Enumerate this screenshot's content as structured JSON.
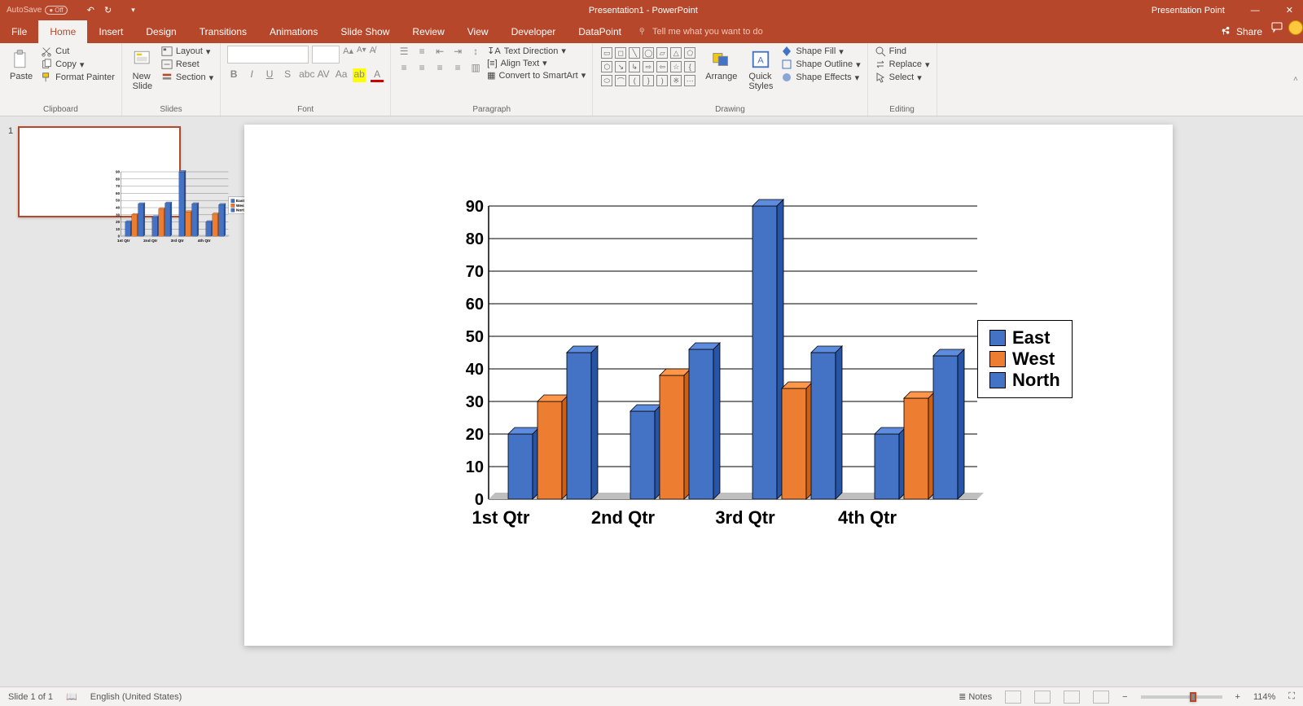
{
  "titlebar": {
    "autosave_label": "AutoSave",
    "autosave_state": "Off",
    "title": "Presentation1 - PowerPoint",
    "brand_right": "Presentation Point"
  },
  "tabs": {
    "items": [
      "File",
      "Home",
      "Insert",
      "Design",
      "Transitions",
      "Animations",
      "Slide Show",
      "Review",
      "View",
      "Developer",
      "DataPoint"
    ],
    "active": "Home",
    "tell_me": "Tell me what you want to do",
    "share": "Share"
  },
  "ribbon": {
    "clipboard": {
      "label": "Clipboard",
      "paste": "Paste",
      "cut": "Cut",
      "copy": "Copy",
      "format_painter": "Format Painter"
    },
    "slides": {
      "label": "Slides",
      "new_slide": "New\nSlide",
      "layout": "Layout",
      "reset": "Reset",
      "section": "Section"
    },
    "font": {
      "label": "Font",
      "font_name": "",
      "font_size": ""
    },
    "paragraph": {
      "label": "Paragraph",
      "text_direction": "Text Direction",
      "align_text": "Align Text",
      "smartart": "Convert to SmartArt"
    },
    "drawing": {
      "label": "Drawing",
      "arrange": "Arrange",
      "quick_styles": "Quick\nStyles",
      "shape_fill": "Shape Fill",
      "shape_outline": "Shape Outline",
      "shape_effects": "Shape Effects"
    },
    "editing": {
      "label": "Editing",
      "find": "Find",
      "replace": "Replace",
      "select": "Select"
    }
  },
  "thumbs": {
    "num": "1"
  },
  "statusbar": {
    "slide_pos": "Slide 1 of 1",
    "lang": "English (United States)",
    "notes": "Notes",
    "zoom": "114%"
  },
  "chart_data": {
    "type": "bar",
    "categories": [
      "1st Qtr",
      "2nd Qtr",
      "3rd Qtr",
      "4th Qtr"
    ],
    "series": [
      {
        "name": "East",
        "color": "#4472c4",
        "values": [
          20,
          27,
          90,
          20
        ]
      },
      {
        "name": "West",
        "color": "#ed7d31",
        "values": [
          30,
          38,
          34,
          31
        ]
      },
      {
        "name": "North",
        "color": "#4472c4",
        "values": [
          45,
          46,
          45,
          44
        ]
      }
    ],
    "ylabel": "",
    "xlabel": "",
    "ylim": [
      0,
      90
    ],
    "yticks": [
      0,
      10,
      20,
      30,
      40,
      50,
      60,
      70,
      80,
      90
    ],
    "legend_position": "right"
  }
}
